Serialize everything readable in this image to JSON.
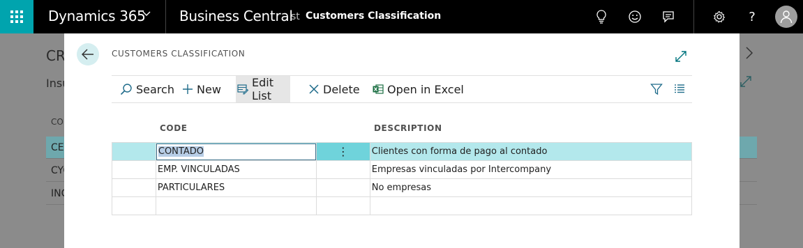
{
  "topbar": {
    "brand": "Dynamics 365",
    "app_name": "Business Central",
    "crumb_partial": "st",
    "crumb": "Customers Classification",
    "icons": [
      "lightbulb-icon",
      "smiley-icon",
      "chat-icon",
      "gear-icon",
      "help-icon",
      "user-avatar-icon"
    ],
    "help_glyph": "?"
  },
  "background": {
    "title": "CR",
    "subtitle": "Insu",
    "column_header": "CO",
    "rows": [
      "CES",
      "CYO",
      "INC"
    ]
  },
  "dialog": {
    "title": "CUSTOMERS CLASSIFICATION",
    "actions": {
      "search": "Search",
      "new": "New",
      "edit_list": "Edit List",
      "delete": "Delete",
      "open_in_excel": "Open in Excel"
    },
    "columns": {
      "code": "CODE",
      "description": "DESCRIPTION"
    },
    "rows": [
      {
        "code": "CONTADO",
        "more": "⋮",
        "description": "Clientes con forma de pago al contado"
      },
      {
        "code": "EMP. VINCULADAS",
        "more": "",
        "description": "Empresas vinculadas por Intercompany"
      },
      {
        "code": "PARTICULARES",
        "more": "",
        "description": "No empresas"
      },
      {
        "code": "",
        "more": "",
        "description": ""
      }
    ]
  },
  "colors": {
    "accent": "#00a4ae",
    "selected_row": "#b3e8ec",
    "topbar": "#000000"
  }
}
